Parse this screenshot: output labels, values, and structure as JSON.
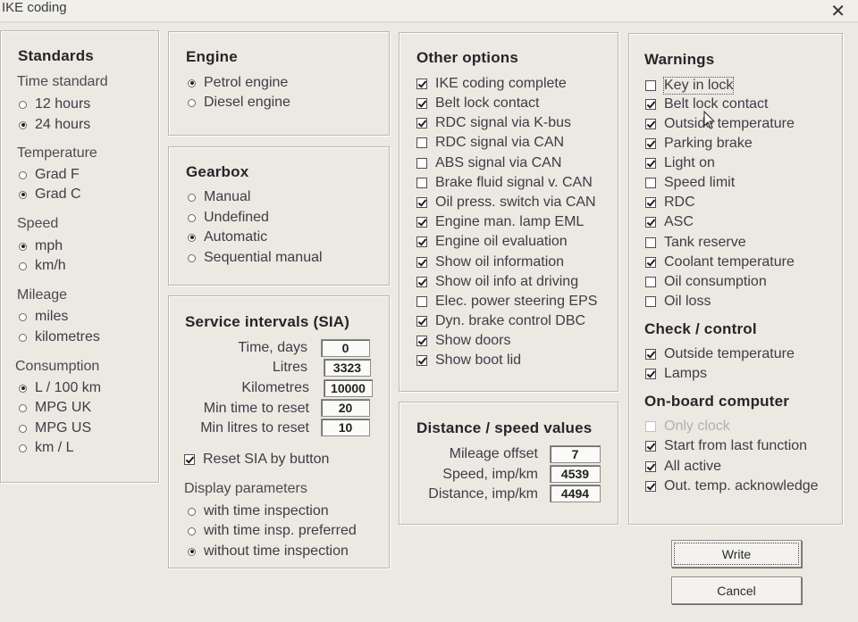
{
  "window": {
    "title": "IKE coding",
    "close_glyph": "✕"
  },
  "standards": {
    "title": "Standards",
    "time_standard": {
      "label": "Time standard",
      "options": [
        {
          "text": "12 hours",
          "selected": false
        },
        {
          "text": "24 hours",
          "selected": true
        }
      ]
    },
    "temperature": {
      "label": "Temperature",
      "options": [
        {
          "text": "Grad F",
          "selected": false
        },
        {
          "text": "Grad C",
          "selected": true
        }
      ]
    },
    "speed": {
      "label": "Speed",
      "options": [
        {
          "text": "mph",
          "selected": true
        },
        {
          "text": "km/h",
          "selected": false
        }
      ]
    },
    "mileage": {
      "label": "Mileage",
      "options": [
        {
          "text": "miles",
          "selected": false,
          "disabled": true
        },
        {
          "text": "kilometres",
          "selected": false,
          "disabled": true
        }
      ]
    },
    "consumption": {
      "label": "Consumption",
      "options": [
        {
          "text": "L / 100 km",
          "selected": true
        },
        {
          "text": "MPG UK",
          "selected": false
        },
        {
          "text": "MPG US",
          "selected": false
        },
        {
          "text": "km / L",
          "selected": false
        }
      ]
    }
  },
  "engine": {
    "title": "Engine",
    "options": [
      {
        "text": "Petrol engine",
        "selected": true
      },
      {
        "text": "Diesel engine",
        "selected": false
      }
    ]
  },
  "gearbox": {
    "title": "Gearbox",
    "options": [
      {
        "text": "Manual",
        "selected": false
      },
      {
        "text": "Undefined",
        "selected": false
      },
      {
        "text": "Automatic",
        "selected": true
      },
      {
        "text": "Sequential manual",
        "selected": false
      }
    ]
  },
  "sia": {
    "title": "Service intervals (SIA)",
    "fields": [
      {
        "label": "Time, days",
        "value": "0"
      },
      {
        "label": "Litres",
        "value": "3323"
      },
      {
        "label": "Kilometres",
        "value": "10000"
      },
      {
        "label": "Min time to reset",
        "value": "20"
      },
      {
        "label": "Min litres to reset",
        "value": "10"
      }
    ],
    "reset_by_button": {
      "text": "Reset SIA by button",
      "checked": true
    },
    "display_label": "Display parameters",
    "display_options": [
      {
        "text": "with time inspection",
        "selected": false
      },
      {
        "text": "with time insp. preferred",
        "selected": false
      },
      {
        "text": "without time inspection",
        "selected": true
      }
    ]
  },
  "other_options": {
    "title": "Other options",
    "items": [
      {
        "text": "IKE coding complete",
        "checked": true
      },
      {
        "text": "Belt lock contact",
        "checked": true
      },
      {
        "text": "RDC signal via K-bus",
        "checked": true
      },
      {
        "text": "RDC signal via CAN",
        "checked": false
      },
      {
        "text": "ABS signal via CAN",
        "checked": false
      },
      {
        "text": "Brake fluid signal v. CAN",
        "checked": false
      },
      {
        "text": "Oil press. switch via CAN",
        "checked": true
      },
      {
        "text": "Engine man. lamp EML",
        "checked": true
      },
      {
        "text": "Engine oil evaluation",
        "checked": true
      },
      {
        "text": "Show oil information",
        "checked": true
      },
      {
        "text": "Show oil info at driving",
        "checked": true
      },
      {
        "text": "Elec. power steering EPS",
        "checked": false
      },
      {
        "text": "Dyn. brake control DBC",
        "checked": true
      },
      {
        "text": "Show doors",
        "checked": true
      },
      {
        "text": "Show boot lid",
        "checked": true
      }
    ]
  },
  "distance": {
    "title": "Distance / speed values",
    "fields": [
      {
        "label": "Mileage offset",
        "value": "7"
      },
      {
        "label": "Speed, imp/km",
        "value": "4539"
      },
      {
        "label": "Distance, imp/km",
        "value": "4494"
      }
    ]
  },
  "warnings": {
    "title": "Warnings",
    "items": [
      {
        "text": "Key in lock",
        "checked": false
      },
      {
        "text": "Belt lock contact",
        "checked": true
      },
      {
        "text": "Outside temperature",
        "checked": true
      },
      {
        "text": "Parking brake",
        "checked": true
      },
      {
        "text": "Light on",
        "checked": true
      },
      {
        "text": "Speed limit",
        "checked": false
      },
      {
        "text": "RDC",
        "checked": true
      },
      {
        "text": "ASC",
        "checked": true
      },
      {
        "text": "Tank reserve",
        "checked": false
      },
      {
        "text": "Coolant temperature",
        "checked": true
      },
      {
        "text": "Oil consumption",
        "checked": false
      },
      {
        "text": "Oil loss",
        "checked": false
      }
    ]
  },
  "check_control": {
    "title": "Check / control",
    "items": [
      {
        "text": "Outside temperature",
        "checked": true
      },
      {
        "text": "Lamps",
        "checked": true
      }
    ]
  },
  "onboard": {
    "title": "On-board computer",
    "items": [
      {
        "text": "Only clock",
        "checked": false,
        "disabled": true
      },
      {
        "text": "Start from last function",
        "checked": true
      },
      {
        "text": "All active",
        "checked": true
      },
      {
        "text": "Out. temp. acknowledge",
        "checked": true
      }
    ]
  },
  "buttons": {
    "write": "Write",
    "cancel": "Cancel"
  }
}
